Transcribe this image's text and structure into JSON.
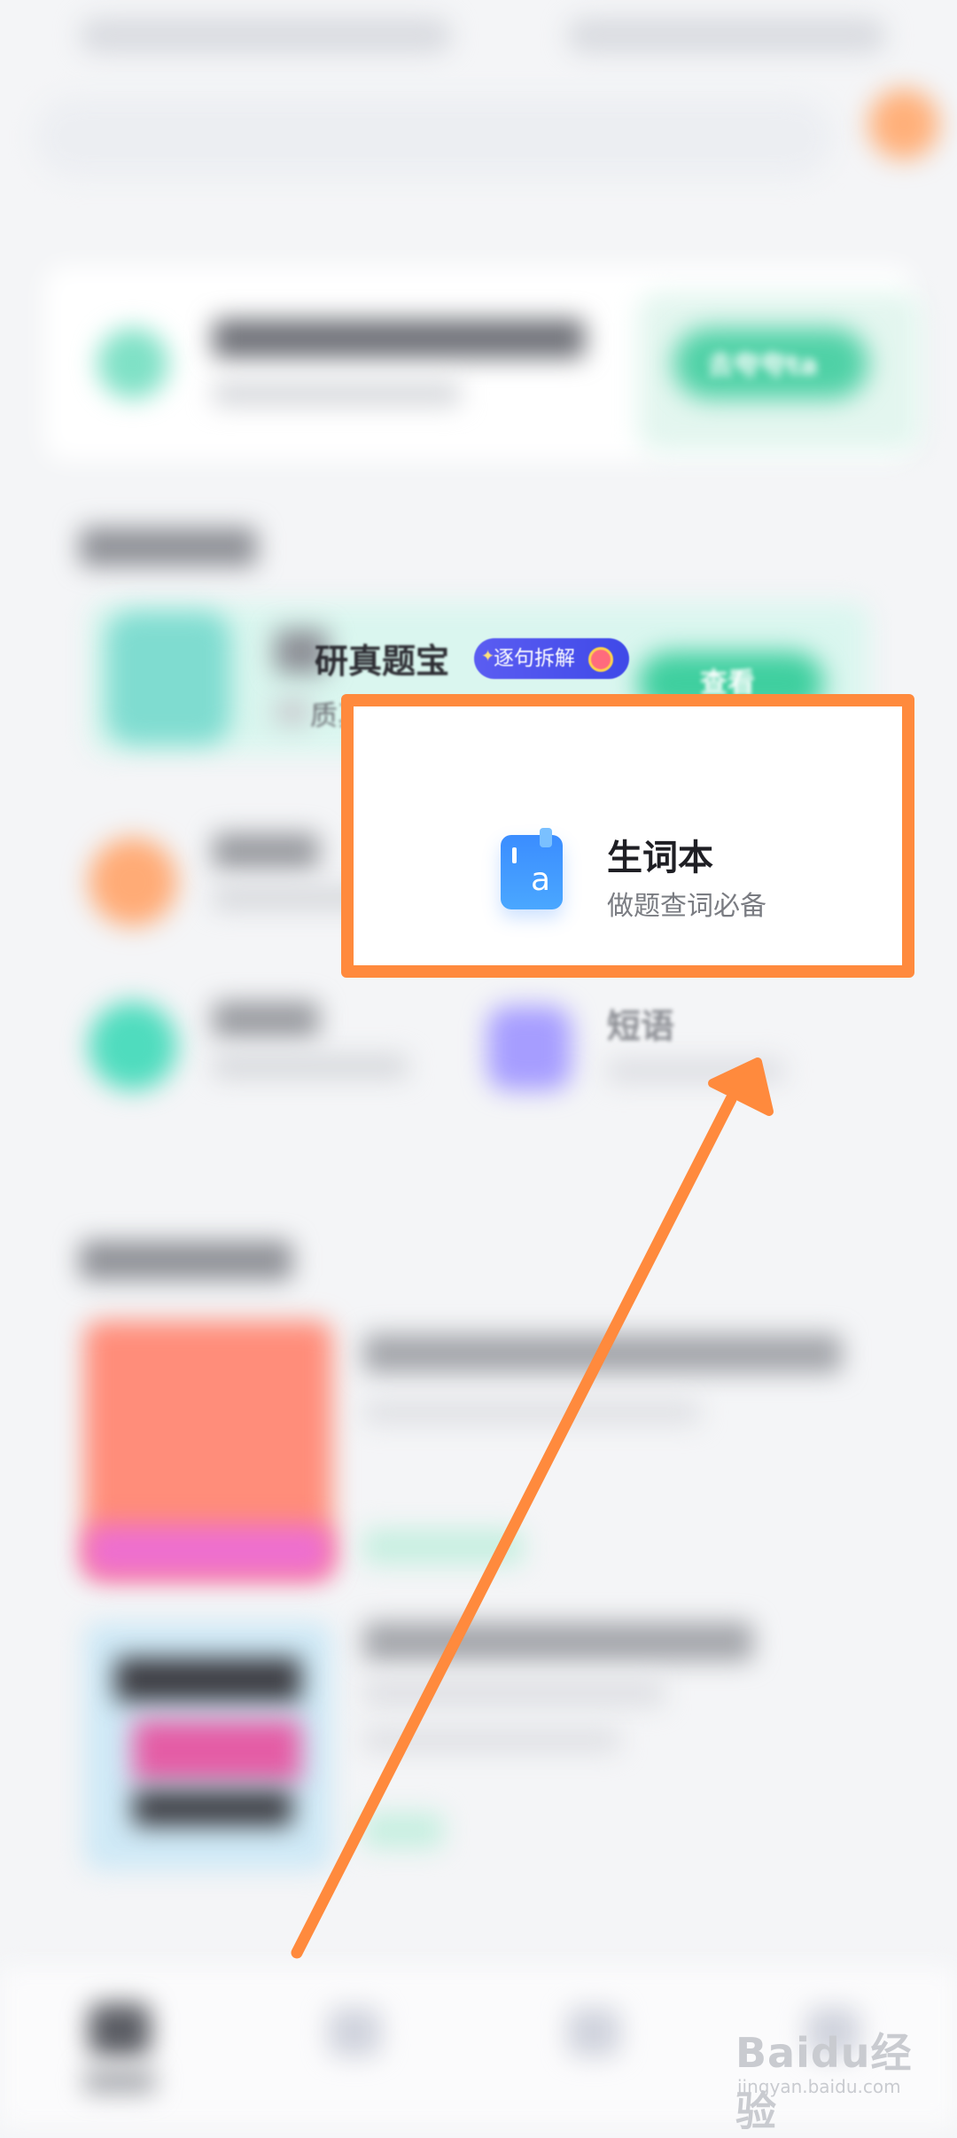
{
  "exam_card": {
    "title": "研真题宝",
    "badge": "逐句拆解",
    "subtitle": "质真题·好搭档",
    "button": "查看"
  },
  "praise_button": "去夸夸ta",
  "vocab_card": {
    "title": "生词本",
    "subtitle": "做题查词必备",
    "icon_letter": "a"
  },
  "phrase_label": "短语",
  "watermark": {
    "logo": "Baidu经验",
    "url": "jingyan.baidu.com"
  },
  "colors": {
    "highlight": "#ff8a3d",
    "arrow": "#ff8a3d",
    "accent_green": "#3fcf9f",
    "vocab_icon_blue": "#3b8dff"
  },
  "icons": [
    "vocab-book-icon"
  ]
}
